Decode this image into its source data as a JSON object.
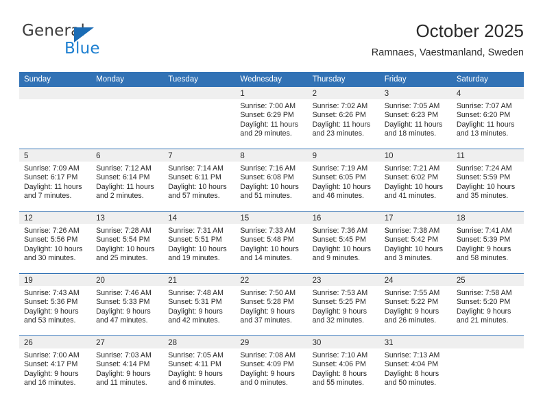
{
  "brand": {
    "name_top": "General",
    "name_bottom": "Blue",
    "triangle_color": "#1b6cb5",
    "blue_text_color": "#1b7ed0"
  },
  "header": {
    "title": "October 2025",
    "subtitle": "Ramnaes, Vaestmanland, Sweden"
  },
  "colors": {
    "header_row_background": "#3272b5",
    "header_row_text": "#ffffff",
    "day_band_background": "#efefef",
    "row_divider": "#3272b5"
  },
  "weekday_headers": [
    "Sunday",
    "Monday",
    "Tuesday",
    "Wednesday",
    "Thursday",
    "Friday",
    "Saturday"
  ],
  "labels": {
    "sunrise_prefix": "Sunrise:",
    "sunset_prefix": "Sunset:",
    "daylight_prefix": "Daylight:"
  },
  "weeks": [
    [
      {
        "day": "",
        "empty": true
      },
      {
        "day": "",
        "empty": true
      },
      {
        "day": "",
        "empty": true
      },
      {
        "day": "1",
        "sunrise": "Sunrise: 7:00 AM",
        "sunset": "Sunset: 6:29 PM",
        "daylight_line1": "Daylight: 11 hours",
        "daylight_line2": "and 29 minutes."
      },
      {
        "day": "2",
        "sunrise": "Sunrise: 7:02 AM",
        "sunset": "Sunset: 6:26 PM",
        "daylight_line1": "Daylight: 11 hours",
        "daylight_line2": "and 23 minutes."
      },
      {
        "day": "3",
        "sunrise": "Sunrise: 7:05 AM",
        "sunset": "Sunset: 6:23 PM",
        "daylight_line1": "Daylight: 11 hours",
        "daylight_line2": "and 18 minutes."
      },
      {
        "day": "4",
        "sunrise": "Sunrise: 7:07 AM",
        "sunset": "Sunset: 6:20 PM",
        "daylight_line1": "Daylight: 11 hours",
        "daylight_line2": "and 13 minutes."
      }
    ],
    [
      {
        "day": "5",
        "sunrise": "Sunrise: 7:09 AM",
        "sunset": "Sunset: 6:17 PM",
        "daylight_line1": "Daylight: 11 hours",
        "daylight_line2": "and 7 minutes."
      },
      {
        "day": "6",
        "sunrise": "Sunrise: 7:12 AM",
        "sunset": "Sunset: 6:14 PM",
        "daylight_line1": "Daylight: 11 hours",
        "daylight_line2": "and 2 minutes."
      },
      {
        "day": "7",
        "sunrise": "Sunrise: 7:14 AM",
        "sunset": "Sunset: 6:11 PM",
        "daylight_line1": "Daylight: 10 hours",
        "daylight_line2": "and 57 minutes."
      },
      {
        "day": "8",
        "sunrise": "Sunrise: 7:16 AM",
        "sunset": "Sunset: 6:08 PM",
        "daylight_line1": "Daylight: 10 hours",
        "daylight_line2": "and 51 minutes."
      },
      {
        "day": "9",
        "sunrise": "Sunrise: 7:19 AM",
        "sunset": "Sunset: 6:05 PM",
        "daylight_line1": "Daylight: 10 hours",
        "daylight_line2": "and 46 minutes."
      },
      {
        "day": "10",
        "sunrise": "Sunrise: 7:21 AM",
        "sunset": "Sunset: 6:02 PM",
        "daylight_line1": "Daylight: 10 hours",
        "daylight_line2": "and 41 minutes."
      },
      {
        "day": "11",
        "sunrise": "Sunrise: 7:24 AM",
        "sunset": "Sunset: 5:59 PM",
        "daylight_line1": "Daylight: 10 hours",
        "daylight_line2": "and 35 minutes."
      }
    ],
    [
      {
        "day": "12",
        "sunrise": "Sunrise: 7:26 AM",
        "sunset": "Sunset: 5:56 PM",
        "daylight_line1": "Daylight: 10 hours",
        "daylight_line2": "and 30 minutes."
      },
      {
        "day": "13",
        "sunrise": "Sunrise: 7:28 AM",
        "sunset": "Sunset: 5:54 PM",
        "daylight_line1": "Daylight: 10 hours",
        "daylight_line2": "and 25 minutes."
      },
      {
        "day": "14",
        "sunrise": "Sunrise: 7:31 AM",
        "sunset": "Sunset: 5:51 PM",
        "daylight_line1": "Daylight: 10 hours",
        "daylight_line2": "and 19 minutes."
      },
      {
        "day": "15",
        "sunrise": "Sunrise: 7:33 AM",
        "sunset": "Sunset: 5:48 PM",
        "daylight_line1": "Daylight: 10 hours",
        "daylight_line2": "and 14 minutes."
      },
      {
        "day": "16",
        "sunrise": "Sunrise: 7:36 AM",
        "sunset": "Sunset: 5:45 PM",
        "daylight_line1": "Daylight: 10 hours",
        "daylight_line2": "and 9 minutes."
      },
      {
        "day": "17",
        "sunrise": "Sunrise: 7:38 AM",
        "sunset": "Sunset: 5:42 PM",
        "daylight_line1": "Daylight: 10 hours",
        "daylight_line2": "and 3 minutes."
      },
      {
        "day": "18",
        "sunrise": "Sunrise: 7:41 AM",
        "sunset": "Sunset: 5:39 PM",
        "daylight_line1": "Daylight: 9 hours",
        "daylight_line2": "and 58 minutes."
      }
    ],
    [
      {
        "day": "19",
        "sunrise": "Sunrise: 7:43 AM",
        "sunset": "Sunset: 5:36 PM",
        "daylight_line1": "Daylight: 9 hours",
        "daylight_line2": "and 53 minutes."
      },
      {
        "day": "20",
        "sunrise": "Sunrise: 7:46 AM",
        "sunset": "Sunset: 5:33 PM",
        "daylight_line1": "Daylight: 9 hours",
        "daylight_line2": "and 47 minutes."
      },
      {
        "day": "21",
        "sunrise": "Sunrise: 7:48 AM",
        "sunset": "Sunset: 5:31 PM",
        "daylight_line1": "Daylight: 9 hours",
        "daylight_line2": "and 42 minutes."
      },
      {
        "day": "22",
        "sunrise": "Sunrise: 7:50 AM",
        "sunset": "Sunset: 5:28 PM",
        "daylight_line1": "Daylight: 9 hours",
        "daylight_line2": "and 37 minutes."
      },
      {
        "day": "23",
        "sunrise": "Sunrise: 7:53 AM",
        "sunset": "Sunset: 5:25 PM",
        "daylight_line1": "Daylight: 9 hours",
        "daylight_line2": "and 32 minutes."
      },
      {
        "day": "24",
        "sunrise": "Sunrise: 7:55 AM",
        "sunset": "Sunset: 5:22 PM",
        "daylight_line1": "Daylight: 9 hours",
        "daylight_line2": "and 26 minutes."
      },
      {
        "day": "25",
        "sunrise": "Sunrise: 7:58 AM",
        "sunset": "Sunset: 5:20 PM",
        "daylight_line1": "Daylight: 9 hours",
        "daylight_line2": "and 21 minutes."
      }
    ],
    [
      {
        "day": "26",
        "sunrise": "Sunrise: 7:00 AM",
        "sunset": "Sunset: 4:17 PM",
        "daylight_line1": "Daylight: 9 hours",
        "daylight_line2": "and 16 minutes."
      },
      {
        "day": "27",
        "sunrise": "Sunrise: 7:03 AM",
        "sunset": "Sunset: 4:14 PM",
        "daylight_line1": "Daylight: 9 hours",
        "daylight_line2": "and 11 minutes."
      },
      {
        "day": "28",
        "sunrise": "Sunrise: 7:05 AM",
        "sunset": "Sunset: 4:11 PM",
        "daylight_line1": "Daylight: 9 hours",
        "daylight_line2": "and 6 minutes."
      },
      {
        "day": "29",
        "sunrise": "Sunrise: 7:08 AM",
        "sunset": "Sunset: 4:09 PM",
        "daylight_line1": "Daylight: 9 hours",
        "daylight_line2": "and 0 minutes."
      },
      {
        "day": "30",
        "sunrise": "Sunrise: 7:10 AM",
        "sunset": "Sunset: 4:06 PM",
        "daylight_line1": "Daylight: 8 hours",
        "daylight_line2": "and 55 minutes."
      },
      {
        "day": "31",
        "sunrise": "Sunrise: 7:13 AM",
        "sunset": "Sunset: 4:04 PM",
        "daylight_line1": "Daylight: 8 hours",
        "daylight_line2": "and 50 minutes."
      },
      {
        "day": "",
        "empty": true
      }
    ]
  ]
}
